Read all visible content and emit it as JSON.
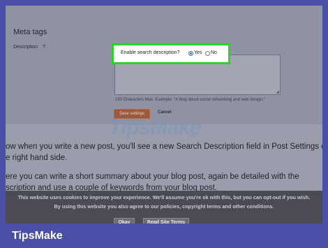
{
  "settings": {
    "meta_title": "Meta tags",
    "description_label": "Description",
    "help_mark": "?",
    "hint": "150 Characters Max. Example: \"A blog about social networking and web design.\"",
    "save_label": "Save settings",
    "cancel_label": "Cancel"
  },
  "popup": {
    "question": "Enable search description?",
    "yes_label": "Yes",
    "no_label": "No",
    "selected": "Yes"
  },
  "watermark": {
    "text": "TipsMake",
    "domain": ".com"
  },
  "article": {
    "line1": "ow when you write a new post, you'll see a new Search Description field in Post Settings on",
    "line2": "e right hand side.",
    "line3": "ere you can write a short summary about your blog post, again be detailed with the",
    "line4": "scription and use a couple of keywords from your blog post."
  },
  "cookie": {
    "line1": "This website uses cookies to improve your experience. We'll assume you're ok with this, but you can opt-out if you wish.",
    "line2": "By using this website you also agree to our policies, copyright terms and other conditions.",
    "okay_label": "Okay",
    "terms_label": "Read Site Terms"
  },
  "brand": {
    "name": "TipsMake"
  },
  "colors": {
    "highlight": "#2bd329",
    "frame": "#4a4fa6"
  }
}
